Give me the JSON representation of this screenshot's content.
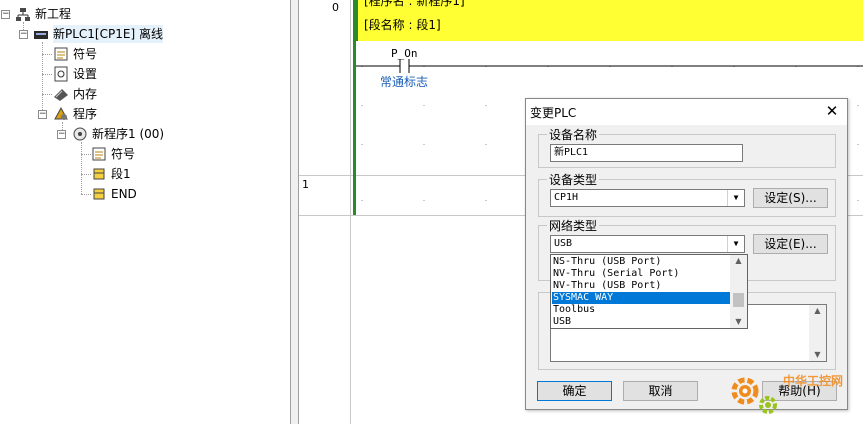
{
  "tree": {
    "root": "新工程",
    "plc": "新PLC1[CP1E] 离线",
    "plc_children": [
      "符号",
      "设置",
      "内存",
      "程序"
    ],
    "program": "新程序1 (00)",
    "program_children": [
      "符号",
      "段1",
      "END"
    ]
  },
  "ladder": {
    "rung0_number": "0",
    "program_name_line": "[程序名 : 新程序1]",
    "section_name_line": "[段名称 : 段1]",
    "contact_operand": "P_On",
    "contact_comment": "常通标志",
    "rung1_number": "1"
  },
  "dialog": {
    "title": "变更PLC",
    "device_name_label": "设备名称",
    "device_name_value": "新PLC1",
    "device_type_label": "设备类型",
    "device_type_value": "CP1H",
    "device_settings_button": "设定(S)...",
    "network_type_label": "网络类型",
    "network_type_value": "USB",
    "network_settings_button": "设定(E)...",
    "network_options": [
      "NS-Thru (USB Port)",
      "NV-Thru (Serial Port)",
      "NV-Thru (USB Port)",
      "SYSMAC WAY",
      "Toolbus",
      "USB"
    ],
    "network_selected_option": "SYSMAC WAY",
    "ok_button": "确定",
    "cancel_button": "取消",
    "help_button": "帮助(H)"
  },
  "watermark": {
    "text": "中华工控网",
    "icon": "gear-logo"
  },
  "colors": {
    "accent_blue": "#0078d7",
    "comment_yellow": "#ffff33",
    "rail_green": "#2a8a2a",
    "watermark_orange": "#f08c1e"
  }
}
